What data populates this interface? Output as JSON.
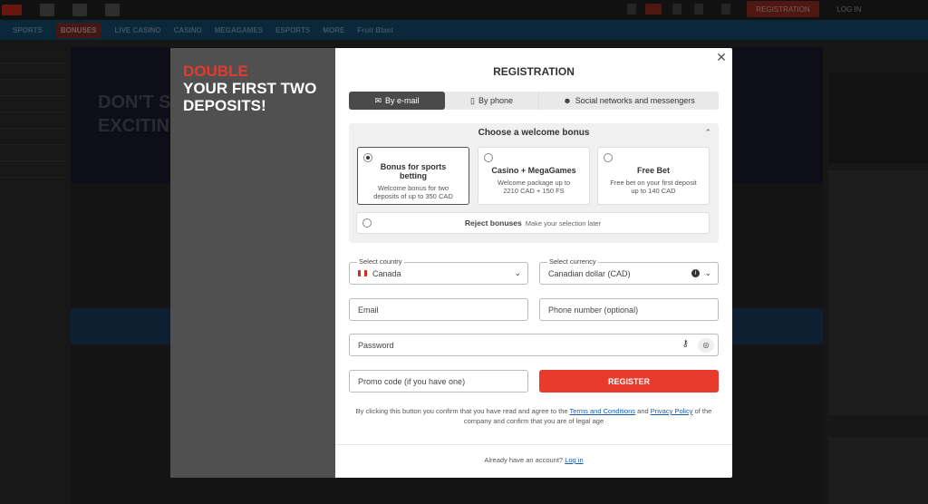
{
  "background": {
    "top_registration_label": "REGISTRATION",
    "top_login_label": "LOG IN",
    "nav_items": [
      "SPORTS",
      "BONUSES",
      "LIVE CASINO",
      "CASINO",
      "MEGAGAMES",
      "ESPORTS",
      "MORE",
      "Fruit Blast"
    ],
    "banner_text_line1": "DON'T ST",
    "banner_text_line2": "EXCITIN"
  },
  "promo_panel": {
    "line1": "DOUBLE",
    "line2": "YOUR FIRST TWO",
    "line3": "DEPOSITS!"
  },
  "modal": {
    "title": "REGISTRATION",
    "close_icon": "close-icon",
    "tabs": [
      {
        "label": "By e-mail",
        "icon": "email-icon",
        "active": true
      },
      {
        "label": "By phone",
        "icon": "phone-icon",
        "active": false
      },
      {
        "label": "Social networks and messengers",
        "icon": "people-icon",
        "active": false
      }
    ],
    "bonus": {
      "title": "Choose a welcome bonus",
      "options": [
        {
          "title": "Bonus for sports betting",
          "desc": "Welcome bonus for two deposits of up to 350 CAD",
          "selected": true
        },
        {
          "title": "Casino + MegaGames",
          "desc": "Welcome package up to 2210 CAD + 150 FS",
          "selected": false
        },
        {
          "title": "Free Bet",
          "desc": "Free bet on your first deposit up to 140 CAD",
          "selected": false
        }
      ],
      "reject_title": "Reject bonuses",
      "reject_desc": "Make your selection later"
    },
    "country": {
      "label": "Select country",
      "value": "Canada"
    },
    "currency": {
      "label": "Select currency",
      "value": "Canadian dollar (CAD)"
    },
    "email_placeholder": "Email",
    "phone_placeholder": "Phone number (optional)",
    "password_placeholder": "Password",
    "promo_placeholder": "Promo code (if you have one)",
    "register_label": "REGISTER",
    "terms": {
      "prefix": "By clicking this button you confirm that you have read and agree to the",
      "terms_link": "Terms and Conditions",
      "and": "and",
      "privacy_link": "Privacy Policy",
      "suffix": "of the company and confirm that you are of legal age"
    },
    "footer": {
      "text": "Already have an account?",
      "link": "Log in"
    }
  }
}
